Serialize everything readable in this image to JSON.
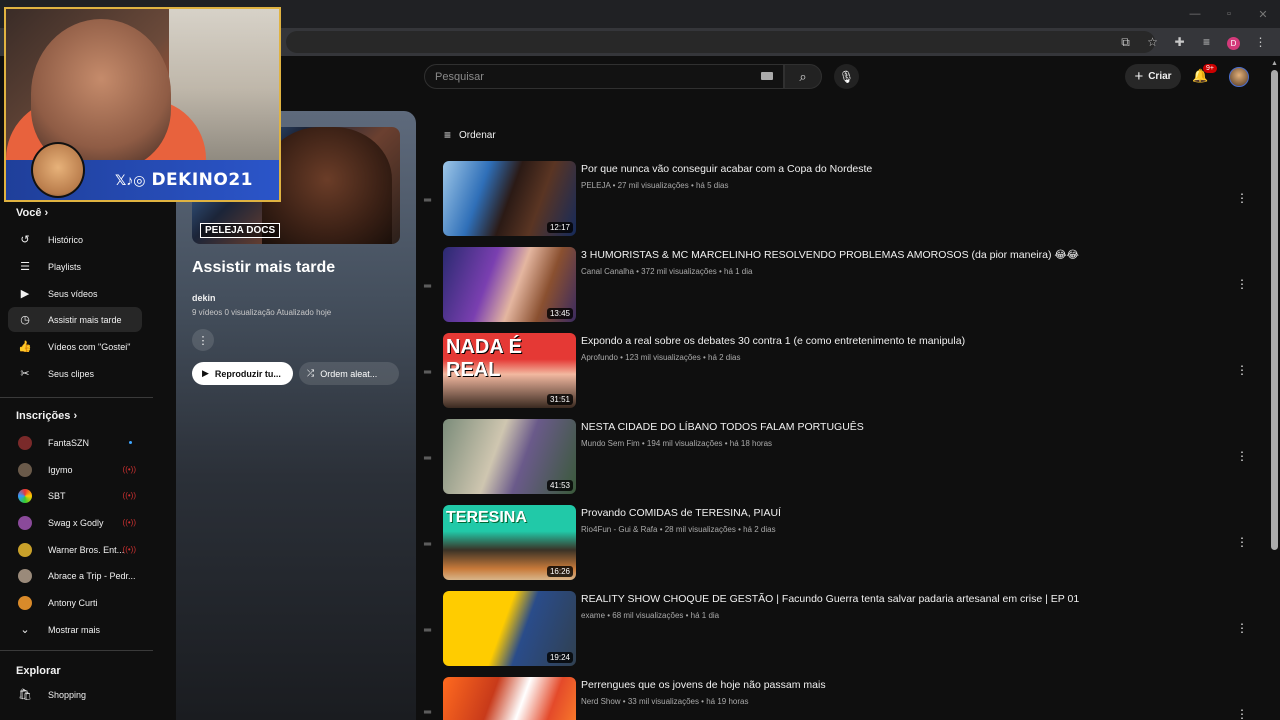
{
  "header": {
    "search_placeholder": "Pesquisar",
    "create_label": "Criar",
    "notification_count": "9+"
  },
  "browser": {
    "profile_initial": "D"
  },
  "webcam": {
    "handle": "DEKINO21",
    "social": "𝕏♪◎"
  },
  "sidebar": {
    "you_title": "Você",
    "you_items": [
      {
        "label": "Histórico",
        "icon": "history-icon"
      },
      {
        "label": "Playlists",
        "icon": "playlists-icon"
      },
      {
        "label": "Seus vídeos",
        "icon": "your-videos-icon"
      },
      {
        "label": "Assistir mais tarde",
        "icon": "watch-later-icon"
      },
      {
        "label": "Vídeos com \"Gostei\"",
        "icon": "thumbs-up-icon"
      },
      {
        "label": "Seus clipes",
        "icon": "clips-icon"
      }
    ],
    "subs_title": "Inscrições",
    "subs": [
      {
        "label": "FantaSZN"
      },
      {
        "label": "Igymo"
      },
      {
        "label": "SBT"
      },
      {
        "label": "Swag x Godly"
      },
      {
        "label": "Warner Bros. Ent..."
      },
      {
        "label": "Abrace a Trip - Pedr..."
      },
      {
        "label": "Antony Curti"
      }
    ],
    "show_more": "Mostrar mais",
    "explore_title": "Explorar",
    "explore_items": [
      {
        "label": "Shopping"
      }
    ]
  },
  "playlist": {
    "title": "Assistir mais tarde",
    "thumb_tag": "PELEJA DOCS",
    "owner": "dekin",
    "meta": "9 vídeos   0 visualização   Atualizado hoje",
    "play_all": "Reproduzir tu...",
    "shuffle": "Ordem aleat..."
  },
  "sort_label": "Ordenar",
  "videos": [
    {
      "title": "Por que nunca vão conseguir acabar com a Copa do Nordeste",
      "meta": "PELEJA • 27 mil visualizações • há 5 dias",
      "duration": "12:17",
      "overlay": ""
    },
    {
      "title": "3 HUMORISTAS & MC MARCELINHO RESOLVENDO PROBLEMAS AMOROSOS (da pior maneira) 😂😂",
      "meta": "Canal Canalha • 372 mil visualizações • há 1 dia",
      "duration": "13:45",
      "overlay": ""
    },
    {
      "title": "Expondo a real sobre os debates 30 contra 1 (e como entretenimento te manipula)",
      "meta": "Aprofundo • 123 mil visualizações • há 2 dias",
      "duration": "31:51",
      "overlay": "NADA É REAL"
    },
    {
      "title": "NESTA CIDADE DO LÍBANO TODOS FALAM PORTUGUÊS",
      "meta": "Mundo Sem Fim • 194 mil visualizações • há 18 horas",
      "duration": "41:53",
      "overlay": ""
    },
    {
      "title": "Provando COMIDAS de TERESINA, PIAUÍ",
      "meta": "Rio4Fun - Gui & Rafa • 28 mil visualizações • há 2 dias",
      "duration": "16:26",
      "overlay": "TERESINA"
    },
    {
      "title": "REALITY SHOW CHOQUE DE GESTÃO | Facundo Guerra tenta salvar padaria artesanal em crise | EP 01",
      "meta": "exame • 68 mil visualizações • há 1 dia",
      "duration": "19:24",
      "overlay": ""
    },
    {
      "title": "Perrengues que os jovens de hoje não passam mais",
      "meta": "Nerd Show • 33 mil visualizações • há 19 horas",
      "duration": "",
      "overlay": ""
    }
  ]
}
